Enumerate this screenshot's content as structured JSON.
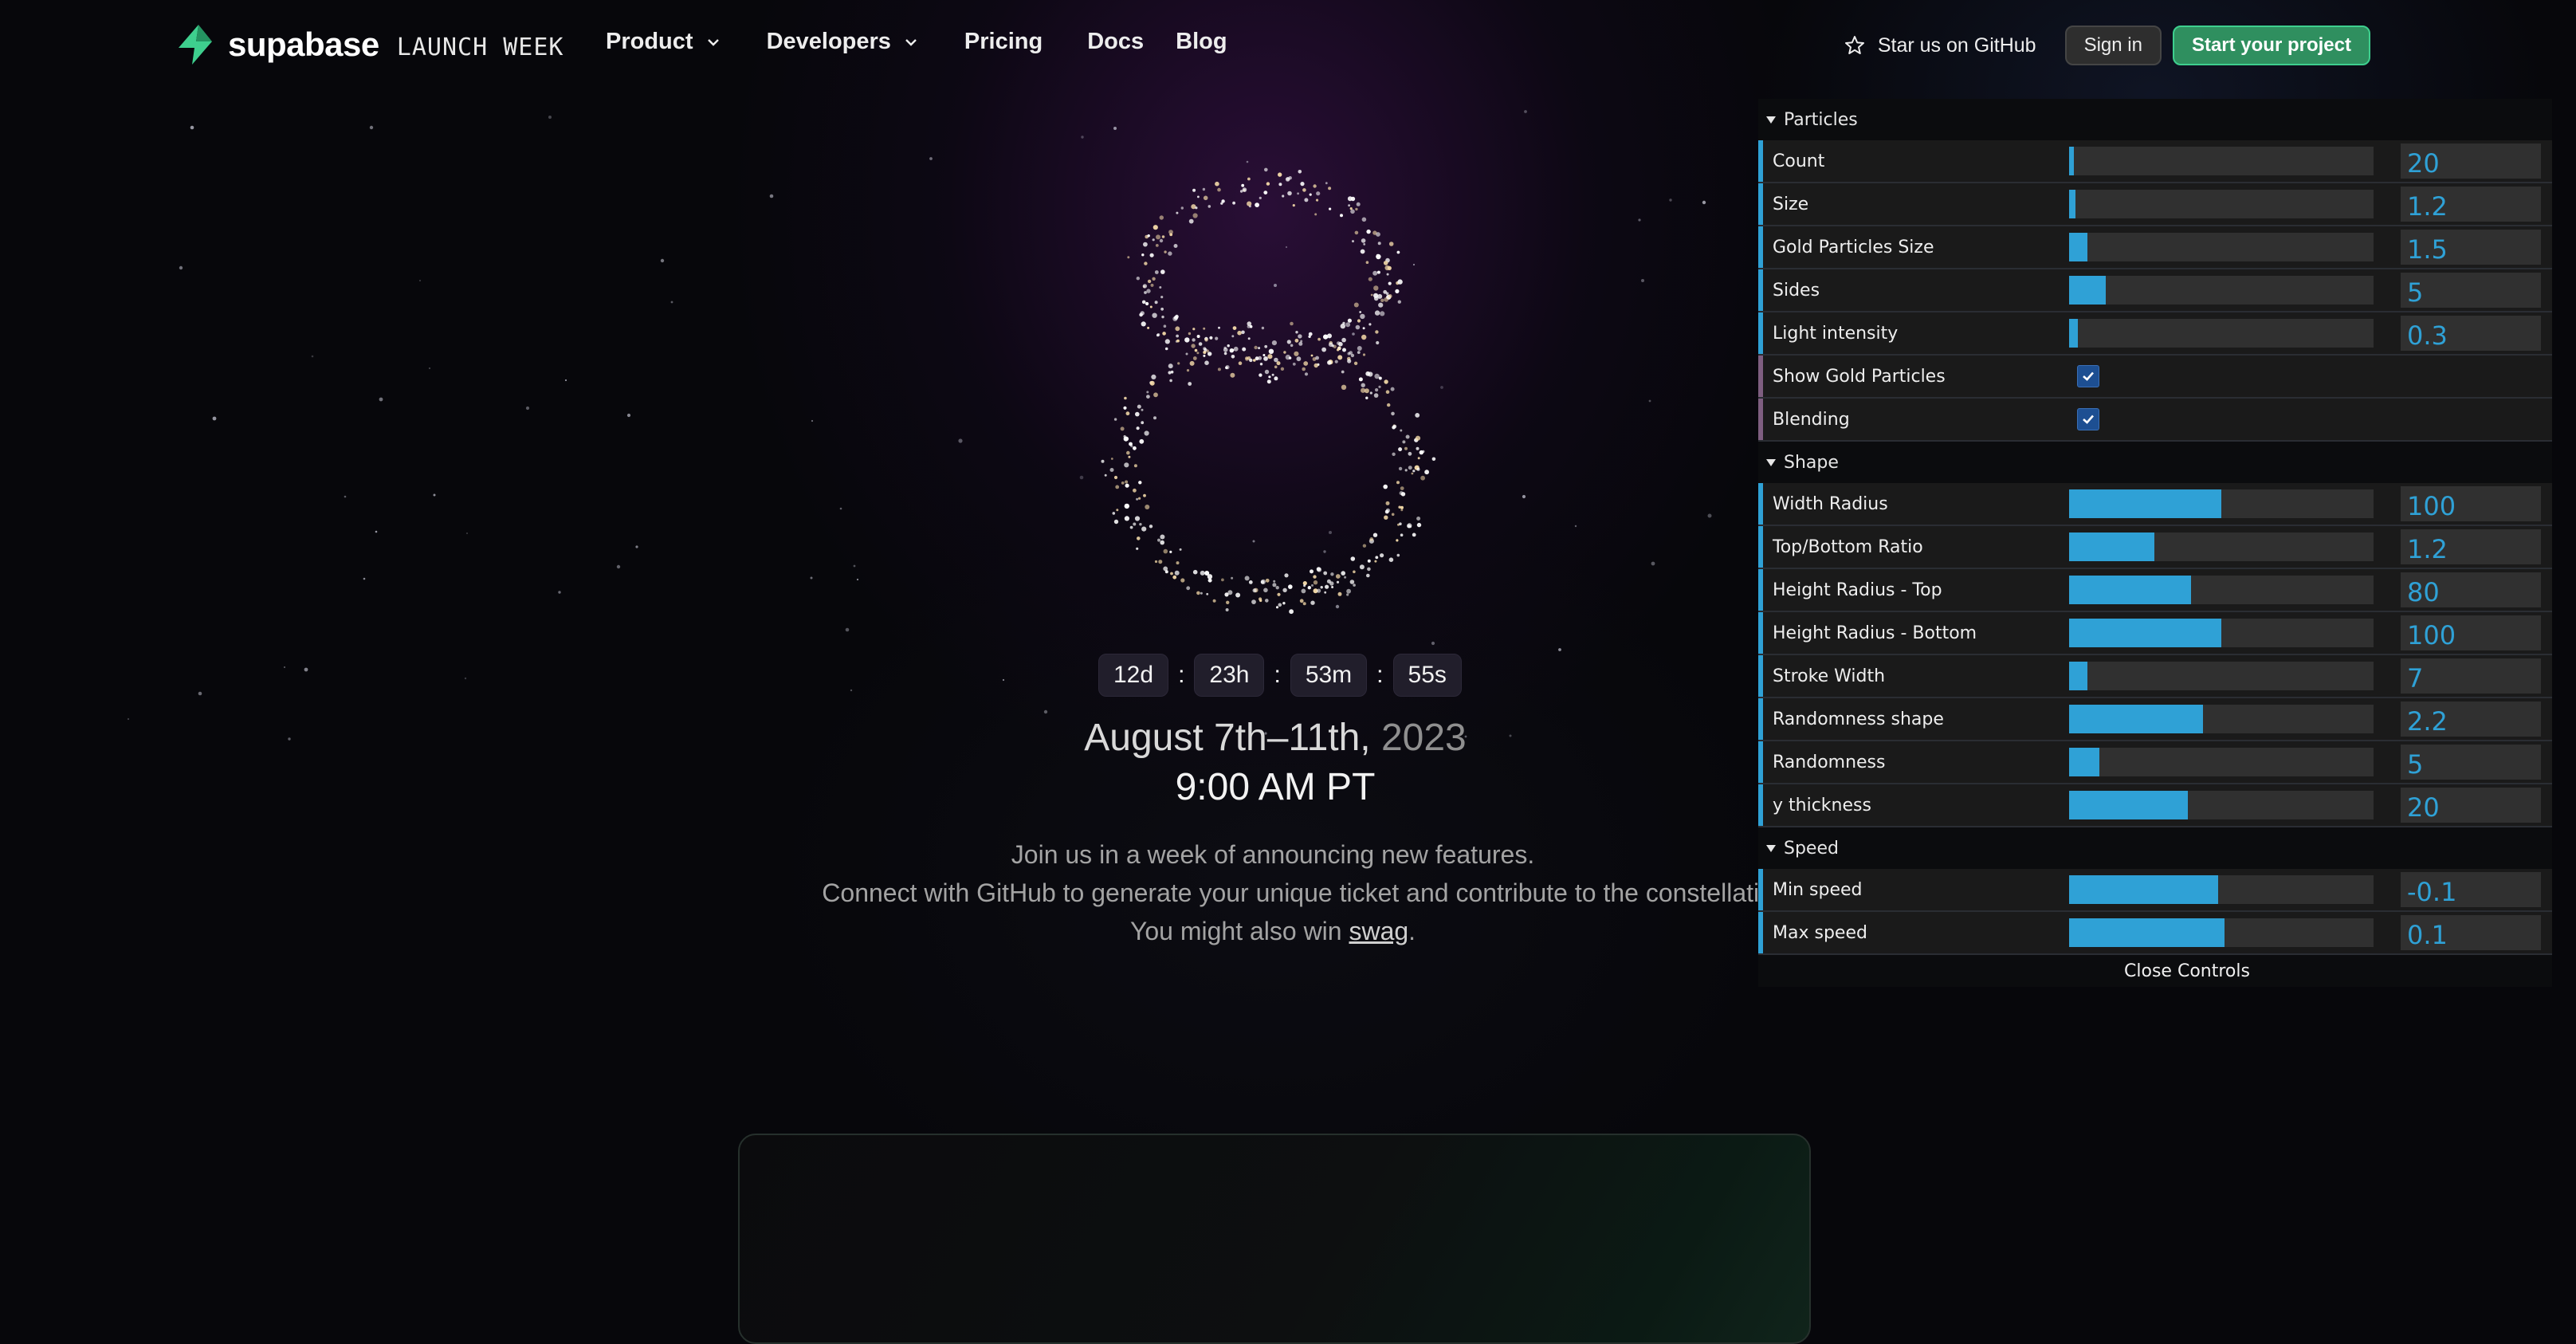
{
  "nav": {
    "brand": "supabase",
    "brand_sub": "LAUNCH WEEK",
    "links": [
      {
        "label": "Product",
        "has_menu": true
      },
      {
        "label": "Developers",
        "has_menu": true
      },
      {
        "label": "Pricing",
        "has_menu": false
      },
      {
        "label": "Docs",
        "has_menu": false
      },
      {
        "label": "Blog",
        "has_menu": false
      }
    ],
    "github_star": "Star us on GitHub",
    "sign_in": "Sign in",
    "start_project": "Start your project",
    "brand_color": "#3ecf8e"
  },
  "hero": {
    "big_numeral": "8",
    "countdown": {
      "days": "12d",
      "hours": "23h",
      "minutes": "53m",
      "seconds": "55s",
      "separator": ":"
    },
    "date_main": "August 7th–11th,",
    "date_year": "2023",
    "time": "9:00 AM PT",
    "desc_line1": "Join us in a week of announcing new features.",
    "desc_line2": "Connect with GitHub to generate your unique ticket and contribute to the constellation",
    "desc_line3_pre": "You might also win ",
    "desc_line3_link": "swag",
    "desc_line3_post": "."
  },
  "controls": {
    "accent": "#2fa1d6",
    "folders": [
      {
        "title": "Particles",
        "rows": [
          {
            "label": "Count",
            "type": "number",
            "value": "20",
            "fill": 0.01
          },
          {
            "label": "Size",
            "type": "number",
            "value": "1.2",
            "fill": 0.02
          },
          {
            "label": "Gold Particles Size",
            "type": "number",
            "value": "1.5",
            "fill": 0.06
          },
          {
            "label": "Sides",
            "type": "number",
            "value": "5",
            "fill": 0.12
          },
          {
            "label": "Light intensity",
            "type": "number",
            "value": "0.3",
            "fill": 0.03
          },
          {
            "label": "Show Gold Particles",
            "type": "bool",
            "checked": true
          },
          {
            "label": "Blending",
            "type": "bool",
            "checked": true
          }
        ]
      },
      {
        "title": "Shape",
        "rows": [
          {
            "label": "Width Radius",
            "type": "number",
            "value": "100",
            "fill": 0.5
          },
          {
            "label": "Top/Bottom Ratio",
            "type": "number",
            "value": "1.2",
            "fill": 0.28
          },
          {
            "label": "Height Radius - Top",
            "type": "number",
            "value": "80",
            "fill": 0.4
          },
          {
            "label": "Height Radius - Bottom",
            "type": "number",
            "value": "100",
            "fill": 0.5
          },
          {
            "label": "Stroke Width",
            "type": "number",
            "value": "7",
            "fill": 0.06
          },
          {
            "label": "Randomness shape",
            "type": "number",
            "value": "2.2",
            "fill": 0.44
          },
          {
            "label": "Randomness",
            "type": "number",
            "value": "5",
            "fill": 0.1
          },
          {
            "label": "y thickness",
            "type": "number",
            "value": "20",
            "fill": 0.39
          }
        ]
      },
      {
        "title": "Speed",
        "rows": [
          {
            "label": "Min speed",
            "type": "number",
            "value": "-0.1",
            "fill": 0.49
          },
          {
            "label": "Max speed",
            "type": "number",
            "value": "0.1",
            "fill": 0.51
          }
        ]
      }
    ],
    "close_label": "Close Controls"
  }
}
